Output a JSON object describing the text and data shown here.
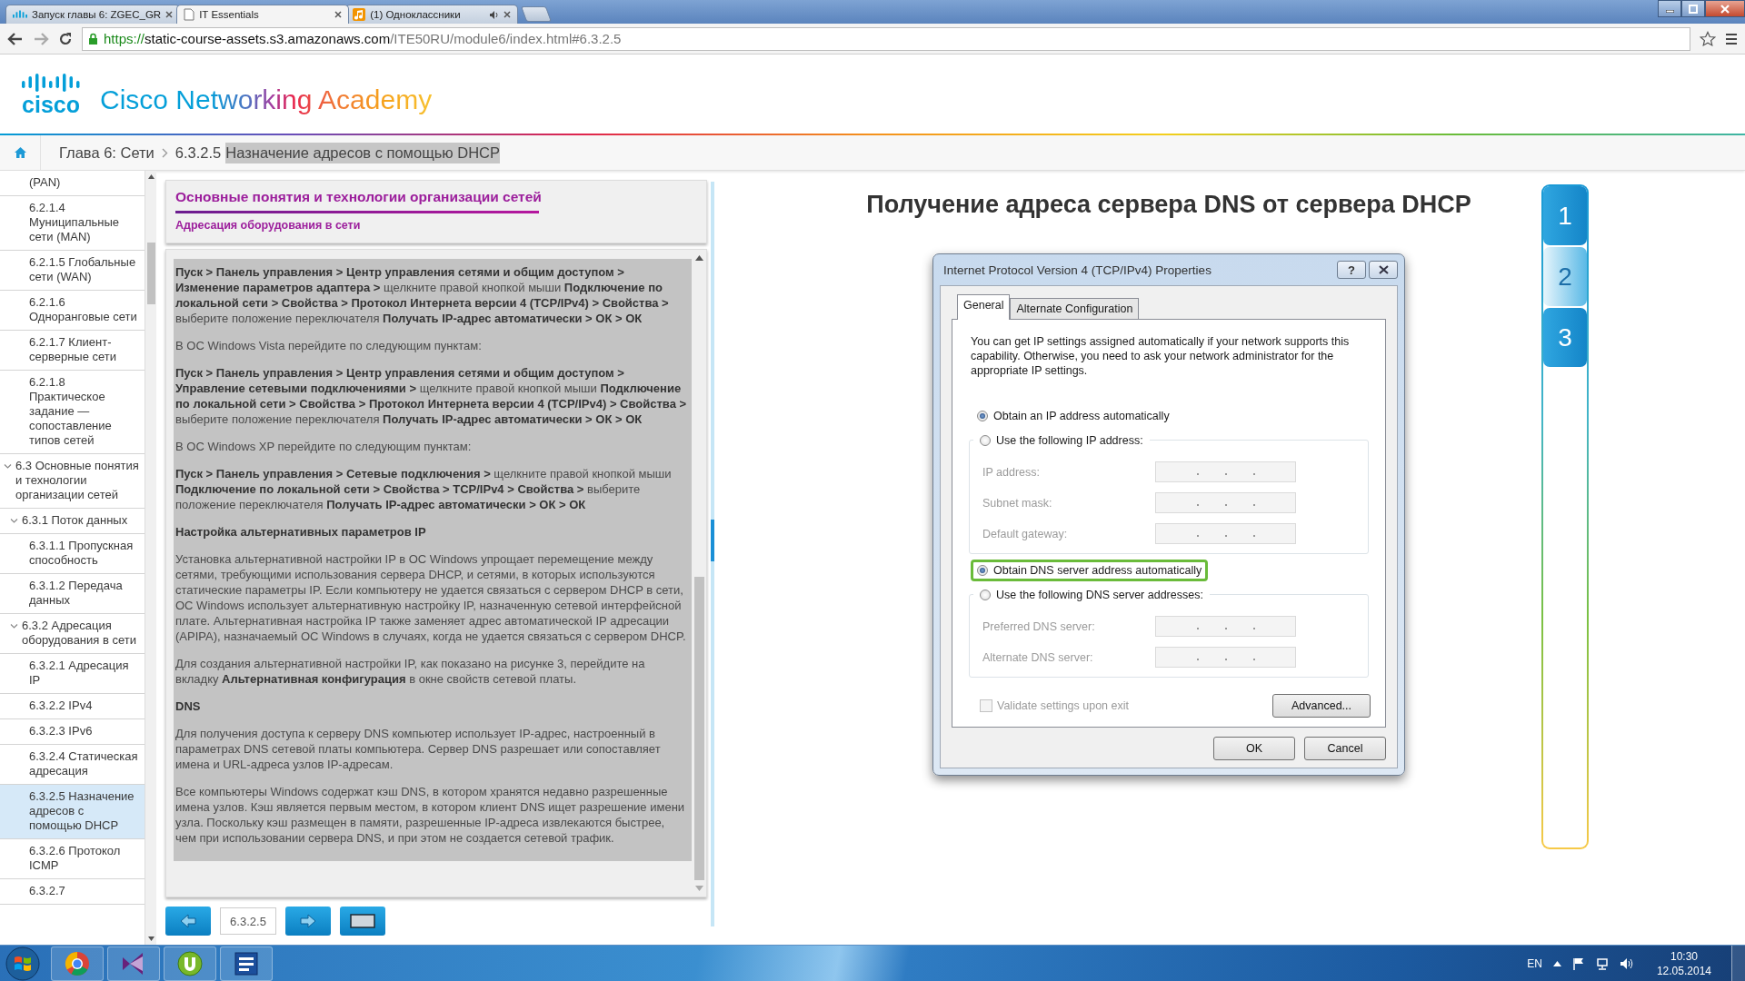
{
  "browser": {
    "tabs": [
      {
        "label": "Запуск главы 6: ZGEC_GR",
        "kind": "bars",
        "selected": false,
        "audio": false
      },
      {
        "label": "IT Essentials",
        "kind": "page",
        "selected": true,
        "audio": false
      },
      {
        "label": "(1) Одноклассники",
        "kind": "music",
        "selected": false,
        "audio": true
      }
    ],
    "url": {
      "scheme": "https://",
      "host": "static-course-assets.s3.amazonaws.com",
      "path": "/ITE50RU/module6/index.html#6.3.2.5"
    }
  },
  "site": {
    "logo_text": "cisco",
    "title": "Cisco Networking Academy"
  },
  "breadcrumb": {
    "chapter": "Глава 6: Сети",
    "section": "6.3.2.5",
    "page": "Назначение адресов с помощью DHCP"
  },
  "sidebar": {
    "items": [
      {
        "label": "(PAN)",
        "selected": false
      },
      {
        "label": "6.2.1.4 Муниципальные сети (MAN)",
        "selected": false
      },
      {
        "label": "6.2.1.5 Глобальные сети (WAN)",
        "selected": false
      },
      {
        "label": "6.2.1.6 Одноранговые сети",
        "selected": false
      },
      {
        "label": "6.2.1.7 Клиент-серверные сети",
        "selected": false
      },
      {
        "label": "6.2.1.8 Практическое задание — сопоставление типов сетей",
        "selected": false
      },
      {
        "label": "6.3 Основные понятия и технологии организации сетей",
        "selected": false,
        "expanded": true,
        "children": [
          {
            "label": "6.3.1 Поток данных",
            "selected": false,
            "expanded": true,
            "children": [
              {
                "label": "6.3.1.1 Пропускная способность",
                "selected": false
              },
              {
                "label": "6.3.1.2 Передача данных",
                "selected": false
              }
            ]
          },
          {
            "label": "6.3.2 Адресация оборудования в сети",
            "selected": false,
            "expanded": true,
            "children": [
              {
                "label": "6.3.2.1 Адресация IP",
                "selected": false
              },
              {
                "label": "6.3.2.2 IPv4",
                "selected": false
              },
              {
                "label": "6.3.2.3 IPv6",
                "selected": false
              },
              {
                "label": "6.3.2.4 Статическая адресация",
                "selected": false
              },
              {
                "label": "6.3.2.5 Назначение адресов с помощью DHCP",
                "selected": true
              },
              {
                "label": "6.3.2.6 Протокол ICMP",
                "selected": false
              },
              {
                "label": "6.3.2.7",
                "selected": false
              }
            ]
          }
        ]
      }
    ]
  },
  "lesson": {
    "title": "Основные понятия и технологии организации сетей",
    "subtitle": "Адресация оборудования в сети",
    "paragraphs": [
      {
        "kind": "text",
        "text": "**Пуск > Панель управления > Центр управления сетями и общим доступом > Изменение параметров адаптера >** щелкните правой кнопкой мыши **Подключение по локальной сети > Свойства > Протокол Интернета версии 4 (TCP/IPv4) > Свойства >** выберите положение переключателя **Получать IP-адрес автоматически > ОК > ОК**"
      },
      {
        "kind": "text",
        "text": "В ОС Windows Vista перейдите по следующим пунктам:"
      },
      {
        "kind": "text",
        "text": "**Пуск > Панель управления > Центр управления сетями и общим доступом > Управление сетевыми подключениями >** щелкните правой кнопкой мыши **Подключение по локальной сети > Свойства > Протокол Интернета версии 4 (TCP/IPv4) > Свойства >** выберите положение переключателя **Получать IP-адрес автоматически > ОК > ОК**"
      },
      {
        "kind": "text",
        "text": "В ОС Windows XP перейдите по следующим пунктам:"
      },
      {
        "kind": "text",
        "text": "**Пуск > Панель управления > Сетевые подключения >** щелкните правой кнопкой мыши **Подключение по локальной сети > Свойства > TCP/IPv4 > Свойства >** выберите положение переключателя **Получать IP-адрес автоматически > ОК > ОК**"
      },
      {
        "kind": "heading",
        "text": "Настройка альтернативных параметров IP"
      },
      {
        "kind": "text",
        "text": "Установка альтернативной настройки IP в ОС Windows упрощает перемещение между сетями, требующими использования сервера DHCP, и сетями, в которых используются статические параметры IP. Если компьютеру не удается связаться с сервером DHCP в сети, ОС Windows использует альтернативную настройку IP, назначенную сетевой интерфейсной плате. Альтернативная настройка IP также заменяет адрес автоматической IP адресации (APIPA), назначаемый ОС Windows в случаях, когда не удается связаться с сервером DHCP."
      },
      {
        "kind": "text",
        "text": "Для создания альтернативной настройки IP, как показано на рисунке 3, перейдите на вкладку **Альтернативная конфигурация** в окне свойств сетевой платы."
      },
      {
        "kind": "heading",
        "text": "DNS"
      },
      {
        "kind": "text",
        "text": "Для получения доступа к серверу DNS компьютер использует IP-адрес, настроенный в параметрах DNS сетевой платы компьютера. Сервер DNS разрешает или сопоставляет имена и URL-адреса узлов IP-адресам."
      },
      {
        "kind": "text",
        "text": "Все компьютеры Windows содержат кэш DNS, в котором хранятся недавно разрешенные имена узлов. Кэш является первым местом, в котором клиент DNS ищет разрешение имени узла. Поскольку кэш размещен в памяти, разрешенные IP-адреса извлекаются быстрее, чем при использовании сервера DNS, и при этом не создается сетевой трафик."
      }
    ],
    "page_field": "6.3.2.5"
  },
  "figure": {
    "title": "Получение адреса сервера DNS от сервера DHCP",
    "dialog": {
      "title": "Internet Protocol Version 4 (TCP/IPv4) Properties",
      "help_label": "?",
      "tabs": [
        {
          "label": "General",
          "selected": true
        },
        {
          "label": "Alternate Configuration",
          "selected": false
        }
      ],
      "description": "You can get IP settings assigned automatically if your network supports this capability. Otherwise, you need to ask your network administrator for the appropriate IP settings.",
      "groups": [
        {
          "options": [
            {
              "label": "Obtain an IP address automatically",
              "selected": true,
              "highlighted": false
            },
            {
              "label": "Use the following IP address:",
              "selected": false,
              "highlighted": false
            }
          ],
          "fields": [
            {
              "label": "IP address:",
              "disabled": true
            },
            {
              "label": "Subnet mask:",
              "disabled": true
            },
            {
              "label": "Default gateway:",
              "disabled": true
            }
          ]
        },
        {
          "options": [
            {
              "label": "Obtain DNS server address automatically",
              "selected": true,
              "highlighted": true
            },
            {
              "label": "Use the following DNS server addresses:",
              "selected": false,
              "highlighted": false
            }
          ],
          "fields": [
            {
              "label": "Preferred DNS server:",
              "disabled": true
            },
            {
              "label": "Alternate DNS server:",
              "disabled": true
            }
          ]
        }
      ],
      "validate": {
        "label": "Validate settings upon exit",
        "checked": false,
        "disabled": true
      },
      "buttons": [
        {
          "label": "Advanced...",
          "kind": "advanced"
        },
        {
          "label": "OK",
          "kind": "ok"
        },
        {
          "label": "Cancel",
          "kind": "cancel"
        }
      ]
    },
    "steps": [
      {
        "label": "1",
        "selected": false
      },
      {
        "label": "2",
        "selected": true
      },
      {
        "label": "3",
        "selected": false
      }
    ]
  },
  "taskbar": {
    "apps": [
      {
        "kind": "chrome"
      },
      {
        "kind": "studio"
      },
      {
        "kind": "torrent"
      },
      {
        "kind": "word"
      }
    ],
    "language": "EN",
    "time": "10:30",
    "date": "12.05.2014"
  }
}
